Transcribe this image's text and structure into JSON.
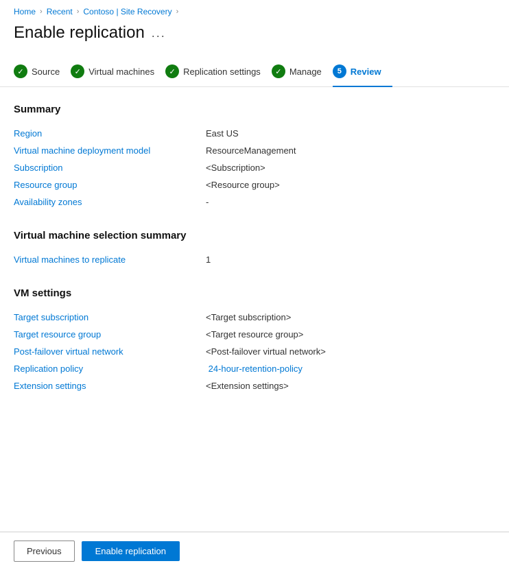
{
  "breadcrumb": {
    "home": "Home",
    "recent": "Recent",
    "contoso": "Contoso",
    "siteRecovery": "Site Recovery"
  },
  "pageTitle": "Enable replication",
  "pageTitleMenu": "...",
  "steps": [
    {
      "id": "source",
      "label": "Source",
      "state": "complete"
    },
    {
      "id": "virtual-machines",
      "label": "Virtual machines",
      "state": "complete"
    },
    {
      "id": "replication-settings",
      "label": "Replication settings",
      "state": "complete"
    },
    {
      "id": "manage",
      "label": "Manage",
      "state": "complete"
    },
    {
      "id": "review",
      "label": "Review",
      "state": "active",
      "number": "5"
    }
  ],
  "summary": {
    "heading": "Summary",
    "rows": [
      {
        "label": "Region",
        "value": "East US",
        "type": "text"
      },
      {
        "label": "Virtual machine deployment model",
        "value": "ResourceManagement",
        "type": "text"
      },
      {
        "label": "Subscription",
        "value": "<Subscription>",
        "type": "text"
      },
      {
        "label": "Resource group",
        "value": "<Resource group>",
        "type": "text"
      },
      {
        "label": "Availability zones",
        "value": "-",
        "type": "text"
      }
    ]
  },
  "vmSelection": {
    "heading": "Virtual machine selection summary",
    "rows": [
      {
        "label": "Virtual machines to replicate",
        "value": "1",
        "type": "text"
      }
    ]
  },
  "vmSettings": {
    "heading": "VM settings",
    "rows": [
      {
        "label": "Target subscription",
        "value": "<Target subscription>",
        "type": "text"
      },
      {
        "label": "Target resource group",
        "value": "<Target resource group>",
        "type": "text"
      },
      {
        "label": "Post-failover virtual network",
        "value": "<Post-failover virtual network>",
        "type": "text"
      },
      {
        "label": "Replication policy",
        "value": "24-hour-retention-policy",
        "type": "link"
      },
      {
        "label": "Extension settings",
        "value": "<Extension settings>",
        "type": "text"
      }
    ]
  },
  "footer": {
    "previousLabel": "Previous",
    "enableLabel": "Enable replication"
  }
}
